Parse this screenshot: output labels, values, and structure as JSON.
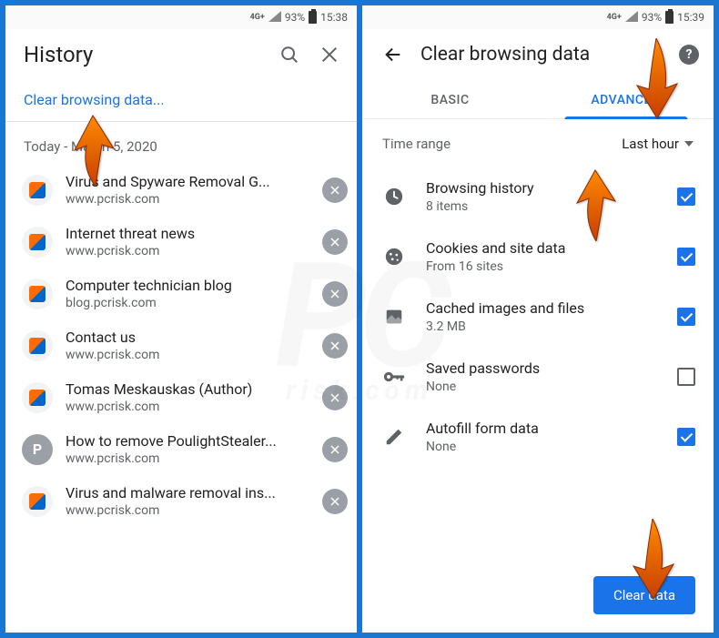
{
  "left": {
    "status": {
      "net": "4G+",
      "battery_pct": "93%",
      "time": "15:38"
    },
    "header": {
      "title": "History"
    },
    "clear_link": "Clear browsing data...",
    "section_header": "Today - March 5, 2020",
    "items": [
      {
        "title": "Virus and Spyware Removal G...",
        "url": "www.pcrisk.com",
        "icon": "orange"
      },
      {
        "title": "Internet threat news",
        "url": "www.pcrisk.com",
        "icon": "orange"
      },
      {
        "title": "Computer technician blog",
        "url": "blog.pcrisk.com",
        "icon": "orange"
      },
      {
        "title": "Contact us",
        "url": "www.pcrisk.com",
        "icon": "orange"
      },
      {
        "title": "Tomas Meskauskas (Author)",
        "url": "www.pcrisk.com",
        "icon": "orange"
      },
      {
        "title": "How to remove PoulightStealer...",
        "url": "www.pcrisk.com",
        "icon": "gray",
        "letter": "P"
      },
      {
        "title": "Virus and malware removal ins...",
        "url": "www.pcrisk.com",
        "icon": "orange"
      }
    ]
  },
  "right": {
    "status": {
      "net": "4G+",
      "battery_pct": "93%",
      "time": "15:39"
    },
    "header": {
      "title": "Clear browsing data"
    },
    "tabs": {
      "basic": "BASIC",
      "advanced": "ADVANCED"
    },
    "time_range": {
      "label": "Time range",
      "value": "Last hour"
    },
    "options": [
      {
        "icon": "clock",
        "title": "Browsing history",
        "sub": "8 items",
        "checked": true
      },
      {
        "icon": "cookie",
        "title": "Cookies and site data",
        "sub": "From 16 sites",
        "checked": true
      },
      {
        "icon": "image",
        "title": "Cached images and files",
        "sub": "3.2 MB",
        "checked": true
      },
      {
        "icon": "key",
        "title": "Saved passwords",
        "sub": "None",
        "checked": false
      },
      {
        "icon": "pencil",
        "title": "Autofill form data",
        "sub": "None",
        "checked": true
      }
    ],
    "clear_button": "Clear data"
  },
  "watermark": {
    "main": "PC",
    "sub": "risk.com"
  }
}
